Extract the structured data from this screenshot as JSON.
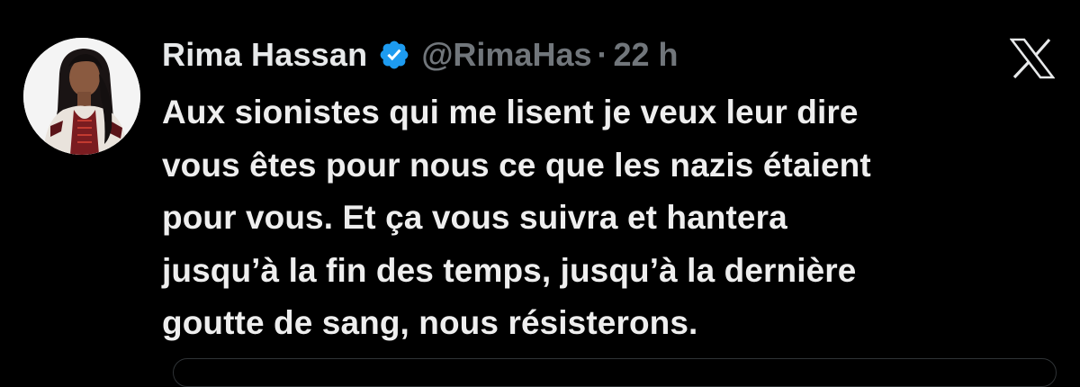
{
  "tweet": {
    "author": {
      "display_name": "Rima Hassan",
      "handle": "@RimaHas",
      "verified": true,
      "verified_icon": "verified-badge-icon",
      "verified_color": "#1d9bf0"
    },
    "separator": "·",
    "timestamp": "22 h",
    "platform_icon": "x-logo-icon",
    "text_lines": [
      "Aux sionistes qui me lisent je veux leur dire",
      "vous êtes pour nous ce que les nazis étaient",
      "pour vous. Et ça vous suivra et hantera",
      "jusqu’à la fin des temps, jusqu’à la dernière",
      "goutte de sang, nous résisterons."
    ]
  },
  "colors": {
    "background": "#000000",
    "primary_text": "#e7e9ea",
    "secondary_text": "#71767b"
  }
}
